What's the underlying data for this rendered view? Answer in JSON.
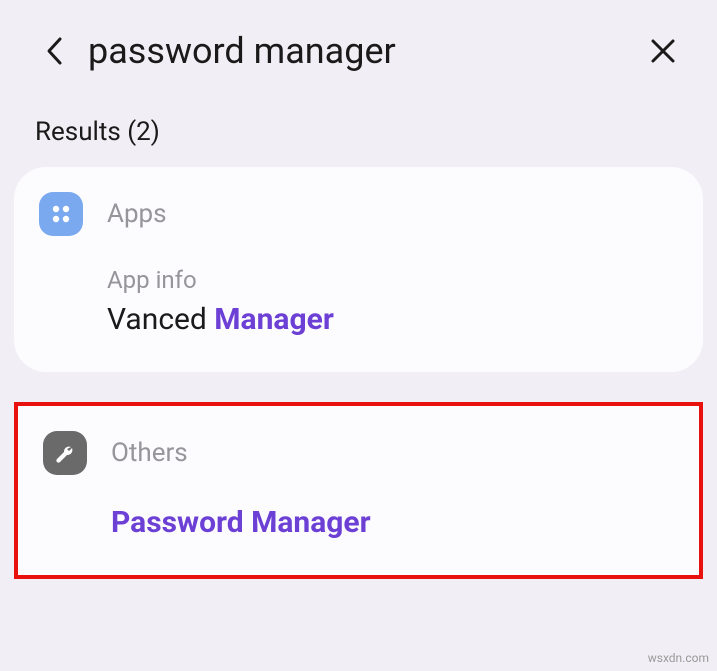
{
  "header": {
    "searchQuery": "password manager"
  },
  "resultsLabel": "Results (2)",
  "cards": {
    "apps": {
      "categoryLabel": "Apps",
      "subtitle": "App info",
      "resultPrefix": "Vanced ",
      "resultHighlight": "Manager"
    },
    "others": {
      "categoryLabel": "Others",
      "result": "Password Manager"
    }
  },
  "watermark": "wsxdn.com"
}
